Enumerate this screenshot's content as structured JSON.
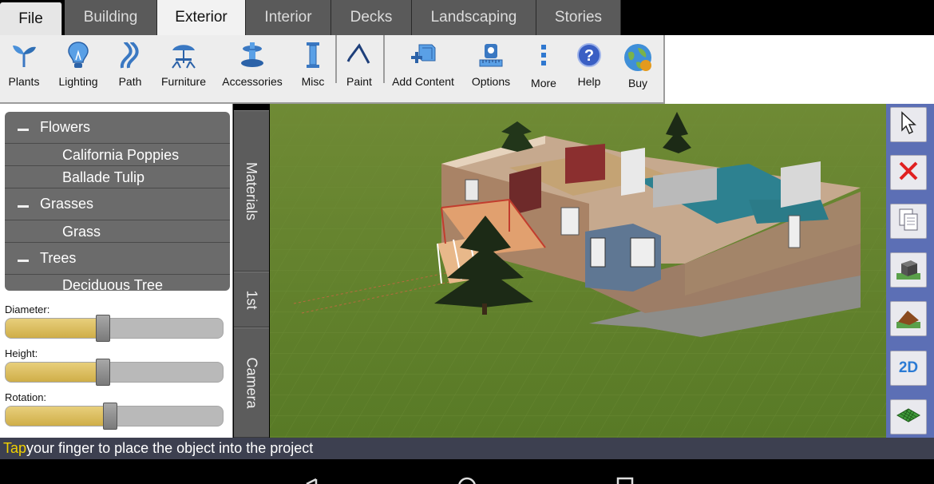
{
  "tabs": [
    {
      "label": "File",
      "state": "file"
    },
    {
      "label": "Building",
      "state": "inactive"
    },
    {
      "label": "Exterior",
      "state": "active"
    },
    {
      "label": "Interior",
      "state": "inactive"
    },
    {
      "label": "Decks",
      "state": "inactive"
    },
    {
      "label": "Landscaping",
      "state": "inactive"
    },
    {
      "label": "Stories",
      "state": "inactive"
    }
  ],
  "toolbar": {
    "items": [
      {
        "label": "Plants",
        "icon": "plant-icon"
      },
      {
        "label": "Lighting",
        "icon": "light-bulb-icon"
      },
      {
        "label": "Path",
        "icon": "path-icon"
      },
      {
        "label": "Furniture",
        "icon": "table-umbrella-icon"
      },
      {
        "label": "Accessories",
        "icon": "fountain-icon"
      },
      {
        "label": "Misc",
        "icon": "pillar-icon"
      },
      {
        "label": "Paint",
        "icon": "paint-icon"
      },
      {
        "label": "Add Content",
        "icon": "add-content-icon"
      },
      {
        "label": "Options",
        "icon": "options-icon"
      },
      {
        "label": "More",
        "icon": "more-icon"
      },
      {
        "label": "Help",
        "icon": "help-icon"
      },
      {
        "label": "Buy",
        "icon": "globe-cart-icon"
      }
    ]
  },
  "plant_list": {
    "categories": [
      {
        "label": "Flowers",
        "items": [
          "California Poppies",
          "Ballade Tulip"
        ]
      },
      {
        "label": "Grasses",
        "items": [
          "Grass"
        ]
      },
      {
        "label": "Trees",
        "items": [
          "Deciduous Tree"
        ]
      }
    ]
  },
  "sliders": [
    {
      "label": "Diameter:",
      "level": 0.45
    },
    {
      "label": "Height:",
      "level": 0.45
    },
    {
      "label": "Rotation:",
      "level": 0.48
    }
  ],
  "side_tabs": {
    "materials": "Materials",
    "floor": "1st",
    "camera": "Camera"
  },
  "right_tools": [
    {
      "icon": "select-arrow-icon"
    },
    {
      "icon": "delete-icon"
    },
    {
      "icon": "copy-icon"
    },
    {
      "icon": "box-icon"
    },
    {
      "icon": "roof-icon"
    },
    {
      "icon": "2d-view-icon",
      "label": "2D"
    },
    {
      "icon": "terrain-icon"
    }
  ],
  "status": {
    "highlight": "Tap",
    "text": " your finger to place the object into the project"
  },
  "colors": {
    "accent_tab": "#f2f2f2",
    "sidebar_blue": "#5c6fb5",
    "slider_fill": "#cfae48",
    "grass": "#5e7d2a",
    "status_highlight": "#f0d000"
  }
}
